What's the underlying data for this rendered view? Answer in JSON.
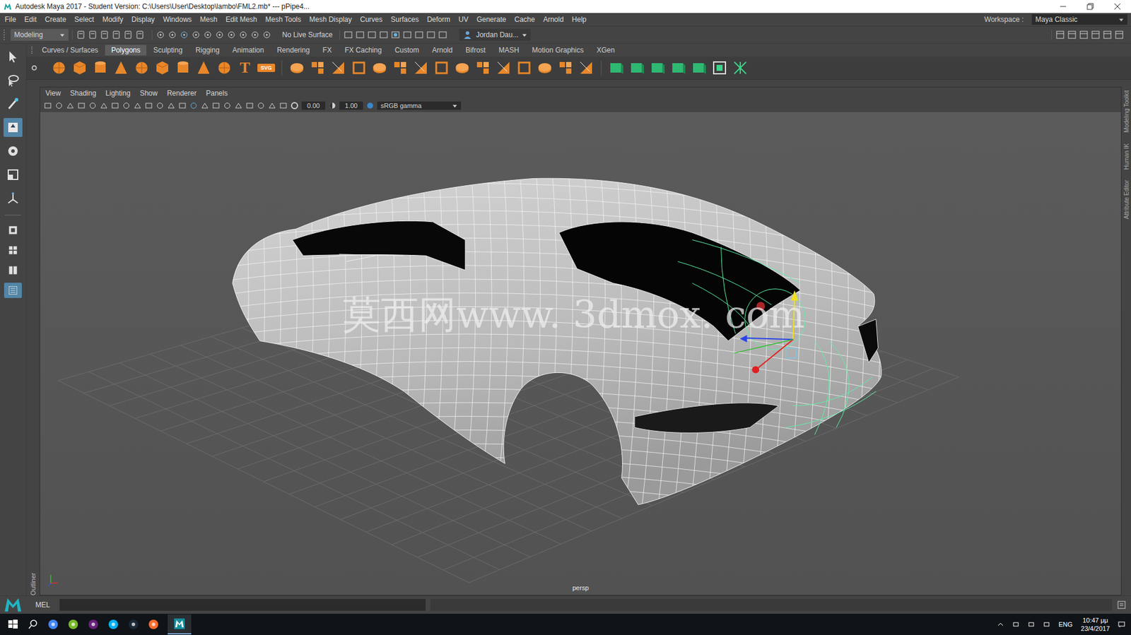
{
  "window": {
    "title": "Autodesk Maya 2017 - Student Version: C:\\Users\\User\\Desktop\\lambo\\FML2.mb*  ---  pPipe4..."
  },
  "menu_bar": {
    "items": [
      "File",
      "Edit",
      "Create",
      "Select",
      "Modify",
      "Display",
      "Windows",
      "Mesh",
      "Edit Mesh",
      "Mesh Tools",
      "Mesh Display",
      "Curves",
      "Surfaces",
      "Deform",
      "UV",
      "Generate",
      "Cache",
      "Arnold",
      "Help"
    ],
    "workspace_label": "Workspace :",
    "workspace": "Maya Classic"
  },
  "status_line": {
    "mode": "Modeling",
    "live_surface": "No Live Surface",
    "user": "Jordan Dau..."
  },
  "shelf": {
    "tabs": [
      {
        "label": "Curves / Surfaces",
        "selected": false
      },
      {
        "label": "Polygons",
        "selected": true
      },
      {
        "label": "Sculpting",
        "selected": false
      },
      {
        "label": "Rigging",
        "selected": false
      },
      {
        "label": "Animation",
        "selected": false
      },
      {
        "label": "Rendering",
        "selected": false
      },
      {
        "label": "FX",
        "selected": false
      },
      {
        "label": "FX Caching",
        "selected": false
      },
      {
        "label": "Custom",
        "selected": false
      },
      {
        "label": "Arnold",
        "selected": false
      },
      {
        "label": "Bifrost",
        "selected": false
      },
      {
        "label": "MASH",
        "selected": false
      },
      {
        "label": "Motion Graphics",
        "selected": false
      },
      {
        "label": "XGen",
        "selected": false
      }
    ],
    "text_tool": "T",
    "svg_tool": "SVG"
  },
  "toolbox": {
    "tools": [
      {
        "kind": "select",
        "selected": false
      },
      {
        "kind": "lasso",
        "selected": false
      },
      {
        "kind": "paint",
        "selected": false
      },
      {
        "kind": "move",
        "selected": true
      },
      {
        "kind": "rotate",
        "selected": false
      },
      {
        "kind": "scale",
        "selected": false
      },
      {
        "kind": "soft",
        "selected": false
      }
    ],
    "layouts": [
      {
        "kind": "single",
        "selected": false
      },
      {
        "kind": "quad",
        "selected": false
      },
      {
        "kind": "split",
        "selected": false
      },
      {
        "kind": "outliner",
        "selected": true
      }
    ]
  },
  "outliner_tab": "Outliner",
  "panel_menu": [
    "View",
    "Shading",
    "Lighting",
    "Show",
    "Renderer",
    "Panels"
  ],
  "viewport": {
    "exposure": "0.00",
    "gamma": "1.00",
    "color_space": "sRGB gamma",
    "camera": "persp",
    "watermark": "莫西网www. 3dmox. com"
  },
  "side_tabs": [
    "Modeling Toolkit",
    "Human IK",
    "Attribute Editor"
  ],
  "command_line": {
    "language": "MEL"
  },
  "taskbar": {
    "language": "ENG",
    "time": "10:47 μμ",
    "date": "23/4/2017"
  }
}
